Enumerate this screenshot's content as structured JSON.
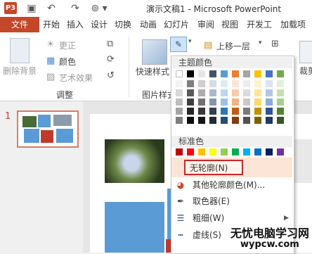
{
  "app": {
    "icon_text": "P3",
    "title": "演示文稿1 - Microsoft PowerPoint"
  },
  "quick_access": [
    {
      "icon": "save-icon",
      "glyph": "▣"
    },
    {
      "icon": "undo-icon",
      "glyph": "↶"
    },
    {
      "icon": "redo-icon",
      "glyph": "↷"
    },
    {
      "icon": "customize-icon",
      "glyph": "▾"
    }
  ],
  "tabs": [
    "文件",
    "开始",
    "插入",
    "设计",
    "切换",
    "动画",
    "幻灯片",
    "审阅",
    "视图",
    "开发工",
    "加载项"
  ],
  "ribbon": {
    "remove_bg": "删除背景",
    "corrections": "更正",
    "color": "颜色",
    "artistic": "艺术效果",
    "adjust_group": "调整",
    "quick_styles": "快速样式",
    "picture_styles_group": "图片样式",
    "bring_forward": "上移一层",
    "crop": "裁剪"
  },
  "slide_panel": {
    "number": "1"
  },
  "dropdown": {
    "theme_colors_header": "主题颜色",
    "standard_colors_header": "标准色",
    "theme_colors": [
      [
        "#ffffff",
        "#000000",
        "#e7e6e6",
        "#44546a",
        "#5b9bd5",
        "#ed7d31",
        "#a5a5a5",
        "#ffc000",
        "#4472c4",
        "#70ad47"
      ],
      [
        "#f2f2f2",
        "#7f7f7f",
        "#d0cece",
        "#d6dce4",
        "#deebf6",
        "#fbe5d5",
        "#ededed",
        "#fff2cc",
        "#dae3f3",
        "#e2efd9"
      ],
      [
        "#d8d8d8",
        "#595959",
        "#aeabab",
        "#adb9ca",
        "#bdd7ee",
        "#f7cbac",
        "#dbdbdb",
        "#ffe599",
        "#b4c6e7",
        "#c5e0b3"
      ],
      [
        "#bfbfbf",
        "#3f3f3f",
        "#757070",
        "#8496b0",
        "#9cc3e5",
        "#f4b183",
        "#c9c9c9",
        "#ffd966",
        "#8eaadb",
        "#a8d08d"
      ],
      [
        "#a5a5a5",
        "#262626",
        "#3a3838",
        "#323f4f",
        "#2e75b5",
        "#c55a11",
        "#7b7b7b",
        "#bf9000",
        "#2f5496",
        "#538135"
      ],
      [
        "#7f7f7f",
        "#0c0c0c",
        "#171616",
        "#222a35",
        "#1e4e79",
        "#833c0b",
        "#525252",
        "#7f6000",
        "#1f3864",
        "#375623"
      ]
    ],
    "standard_colors": [
      "#c00000",
      "#ff0000",
      "#ffc000",
      "#ffff00",
      "#92d050",
      "#00b050",
      "#00b0f0",
      "#0070c0",
      "#002060",
      "#7030a0"
    ],
    "no_outline": "无轮廓(N)",
    "more_colors": "其他轮廓颜色(M)...",
    "eyedropper": "取色器(E)",
    "weight": "粗细(W)",
    "dashes": "虚线(S)"
  },
  "watermark": {
    "line1": "无忧电脑学习网",
    "line2": "wypcw.com"
  }
}
